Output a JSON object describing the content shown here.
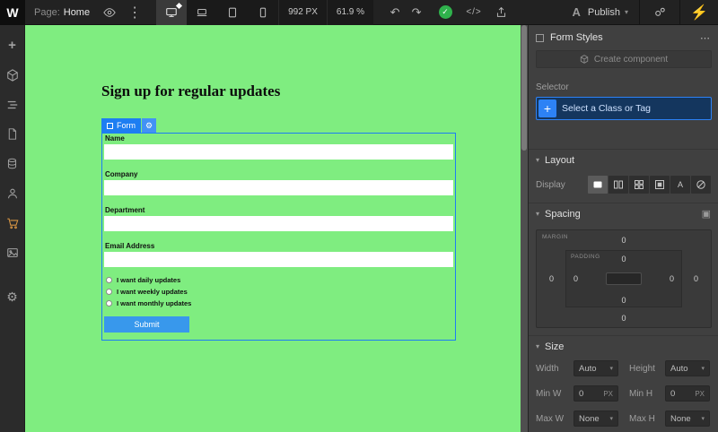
{
  "topbar": {
    "logo": "W",
    "page_label": "Page:",
    "page_name": "Home",
    "breakpoint": "992 PX",
    "zoom": "61.9 %",
    "site_initial": "A",
    "publish_label": "Publish"
  },
  "canvas": {
    "heading": "Sign up for regular updates",
    "form_tag_label": "Form",
    "fields": [
      {
        "label": "Name"
      },
      {
        "label": "Company"
      },
      {
        "label": "Department"
      },
      {
        "label": "Email Address"
      }
    ],
    "radios": [
      {
        "label": "I want daily updates"
      },
      {
        "label": "I want weekly updates"
      },
      {
        "label": "I want monthly updates"
      }
    ],
    "submit_label": "Submit"
  },
  "panel": {
    "selection_title": "Form Styles",
    "create_component_label": "Create component",
    "selector_label": "Selector",
    "selector_placeholder": "Select a Class or Tag",
    "display_label": "Display",
    "sections": {
      "layout": "Layout",
      "spacing": "Spacing",
      "size": "Size"
    },
    "spacing": {
      "margin_label": "MARGIN",
      "padding_label": "PADDING",
      "margin_top": "0",
      "margin_right": "0",
      "margin_bottom": "0",
      "margin_left": "0",
      "padding_top": "0",
      "padding_right": "0",
      "padding_bottom": "0",
      "padding_left": "0"
    },
    "size": {
      "rows": [
        {
          "left_label": "Width",
          "left_value": "Auto",
          "left_caret": "▾",
          "right_label": "Height",
          "right_value": "Auto",
          "right_caret": "▾"
        },
        {
          "left_label": "Min W",
          "left_value": "0",
          "left_unit": "PX",
          "right_label": "Min H",
          "right_value": "0",
          "right_unit": "PX"
        },
        {
          "left_label": "Max W",
          "left_value": "None",
          "left_caret": "▾",
          "right_label": "Max H",
          "right_value": "None",
          "right_caret": "▾"
        }
      ]
    }
  },
  "icons": {
    "ellipsis_v": "⋮",
    "ellipsis_h": "⋯",
    "caret": "▾",
    "check": "✓",
    "code": "</>",
    "undo": "↶",
    "redo": "↷",
    "bolt": "⚡",
    "gear": "⚙",
    "plus": "+",
    "spacing_edit": "▣",
    "inline_a": "A"
  },
  "colors": {
    "canvas_green": "#7fed80",
    "accent_blue": "#1d7ef2",
    "submit_blue": "#3898ec",
    "saved_green": "#2fb24c",
    "cart_orange": "#d79543"
  }
}
